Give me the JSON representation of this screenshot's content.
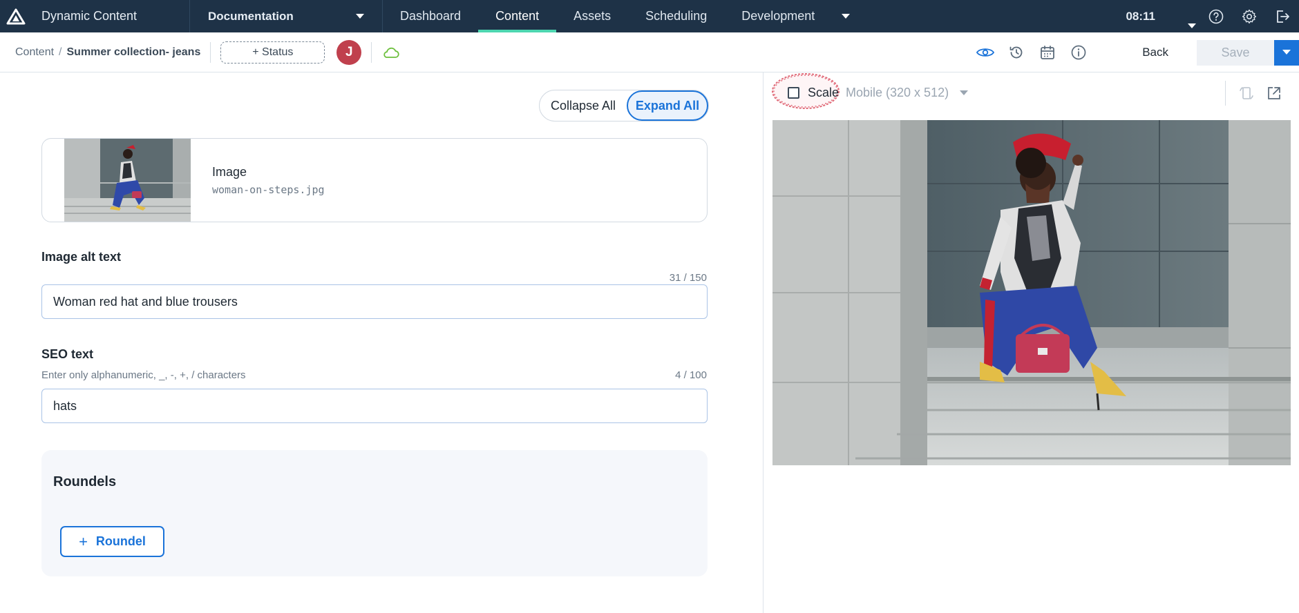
{
  "app": {
    "name": "Dynamic Content",
    "hub": "Documentation",
    "nav_tabs": [
      {
        "label": "Dashboard",
        "active": false
      },
      {
        "label": "Content",
        "active": true
      },
      {
        "label": "Assets",
        "active": false
      },
      {
        "label": "Scheduling",
        "active": false
      },
      {
        "label": "Development",
        "active": false
      }
    ],
    "time": "08:11",
    "icons": [
      "help-icon",
      "gear-icon",
      "logout-icon"
    ]
  },
  "toolbar": {
    "breadcrumb_root": "Content",
    "breadcrumb_sep": "/",
    "breadcrumb_current": "Summer collection- jeans",
    "status_label": "+ Status",
    "avatar_initial": "J",
    "back_label": "Back",
    "save_label": "Save",
    "accent_color": "#1a73d9"
  },
  "form": {
    "collapse_label": "Collapse All",
    "expand_label": "Expand All",
    "image": {
      "label": "Image",
      "filename": "woman-on-steps.jpg"
    },
    "alt_text": {
      "label": "Image alt text",
      "count": "31 / 150",
      "value": "Woman red hat and blue trousers"
    },
    "seo_text": {
      "label": "SEO text",
      "hint": "Enter only alphanumeric, _, -, +, / characters",
      "count": "4 / 100",
      "value": "hats"
    },
    "roundels": {
      "title": "Roundels",
      "add_label": "Roundel"
    }
  },
  "preview": {
    "scale_label": "Scale",
    "scale_checked": false,
    "device": "Mobile (320 x 512)",
    "highlight_color": "#e06a78"
  }
}
